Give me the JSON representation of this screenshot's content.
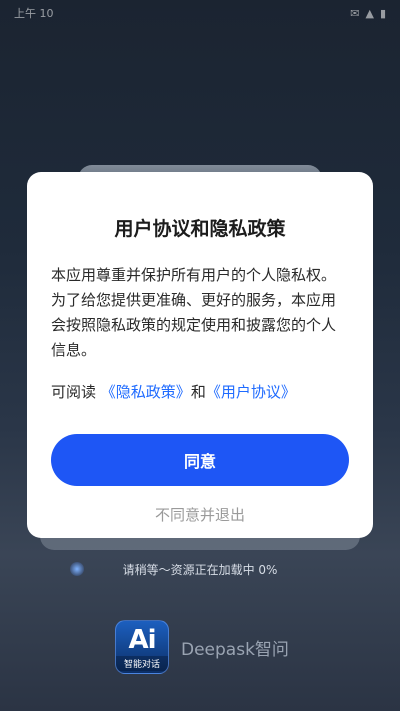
{
  "status_bar": {
    "time": "上午 10",
    "icons": [
      "notification-icon",
      "signal-icon",
      "battery-icon"
    ]
  },
  "dialog": {
    "title": "用户协议和隐私政策",
    "body": "本应用尊重并保护所有用户的个人隐私权。为了给您提供更准确、更好的服务，本应用会按照隐私政策的规定使用和披露您的个人信息。",
    "read_prefix": "可阅读",
    "privacy_link": "《隐私政策》",
    "and_text": "和",
    "agreement_link": "《用户协议》",
    "agree_label": "同意",
    "decline_label": "不同意并退出"
  },
  "loading": {
    "text": "请稍等～资源正在加载中 0%",
    "progress_percent": 0
  },
  "brand": {
    "logo_mark": "Ai",
    "logo_caption": "智能对话",
    "name": "Deepask智问"
  },
  "colors": {
    "accent": "#1e56f5",
    "link": "#1f6bff"
  }
}
